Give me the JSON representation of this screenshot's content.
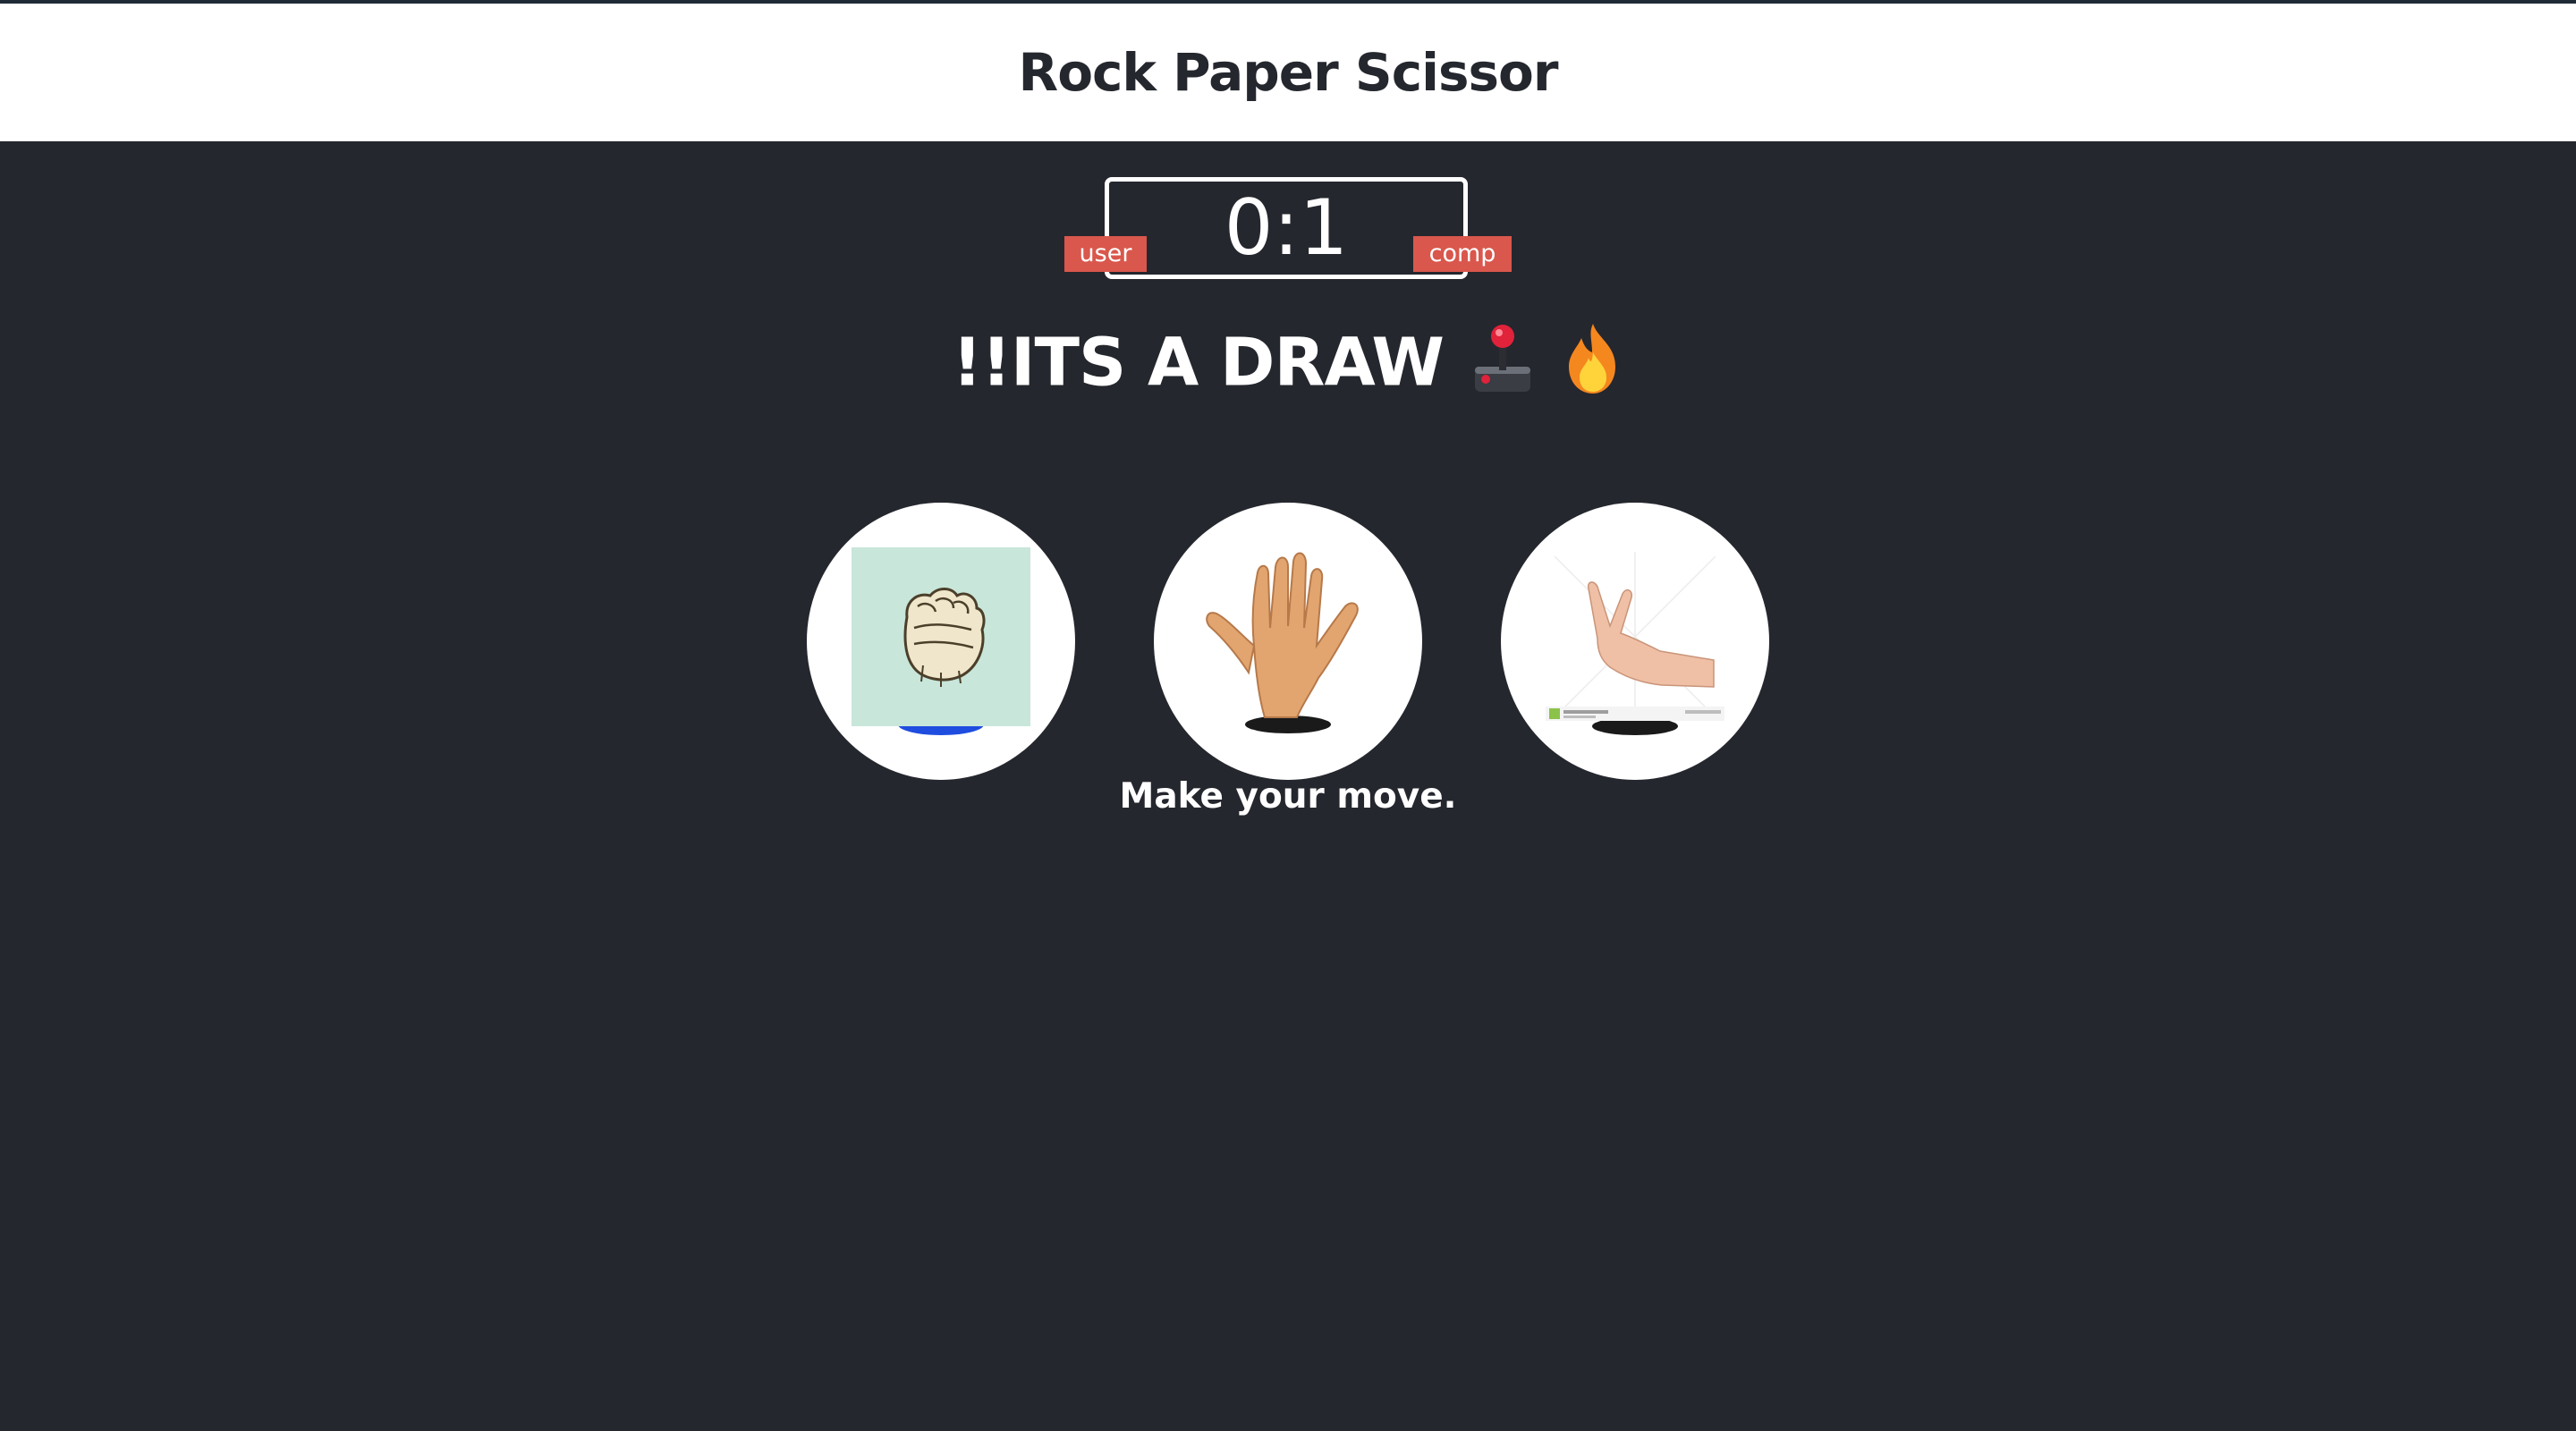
{
  "header": {
    "title": "Rock Paper Scissor"
  },
  "score": {
    "display": "0:1",
    "user_label": "user",
    "comp_label": "comp"
  },
  "result": {
    "message": "!!ITS A DRAW"
  },
  "choices": [
    {
      "name": "rock",
      "icon": "rock-fist-icon"
    },
    {
      "name": "paper",
      "icon": "paper-hand-icon"
    },
    {
      "name": "scissor",
      "icon": "scissor-hand-icon"
    }
  ],
  "prompt": {
    "text": "Make your move."
  },
  "colors": {
    "background": "#25272e",
    "header_bg": "#ffffff",
    "badge": "#d9574c",
    "rock_tile": "#c8e6da"
  }
}
